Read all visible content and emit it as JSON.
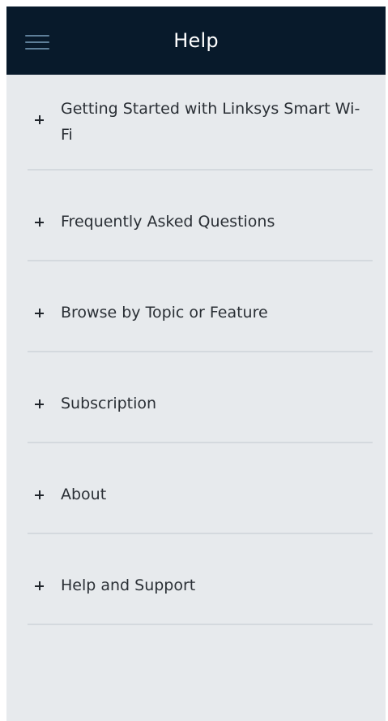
{
  "header": {
    "title": "Help",
    "menu_icon": "hamburger-menu-icon"
  },
  "items": [
    {
      "label": "Getting Started with Linksys Smart Wi-Fi",
      "icon": "plus-icon"
    },
    {
      "label": "Frequently Asked Questions",
      "icon": "plus-icon"
    },
    {
      "label": "Browse by Topic or Feature",
      "icon": "plus-icon"
    },
    {
      "label": "Subscription",
      "icon": "plus-icon"
    },
    {
      "label": "About",
      "icon": "plus-icon"
    },
    {
      "label": "Help and Support",
      "icon": "plus-icon"
    }
  ],
  "colors": {
    "header_bg": "#081a2b",
    "page_bg": "#e7eaed",
    "divider": "#d4d9de",
    "text": "#2a2f35"
  }
}
